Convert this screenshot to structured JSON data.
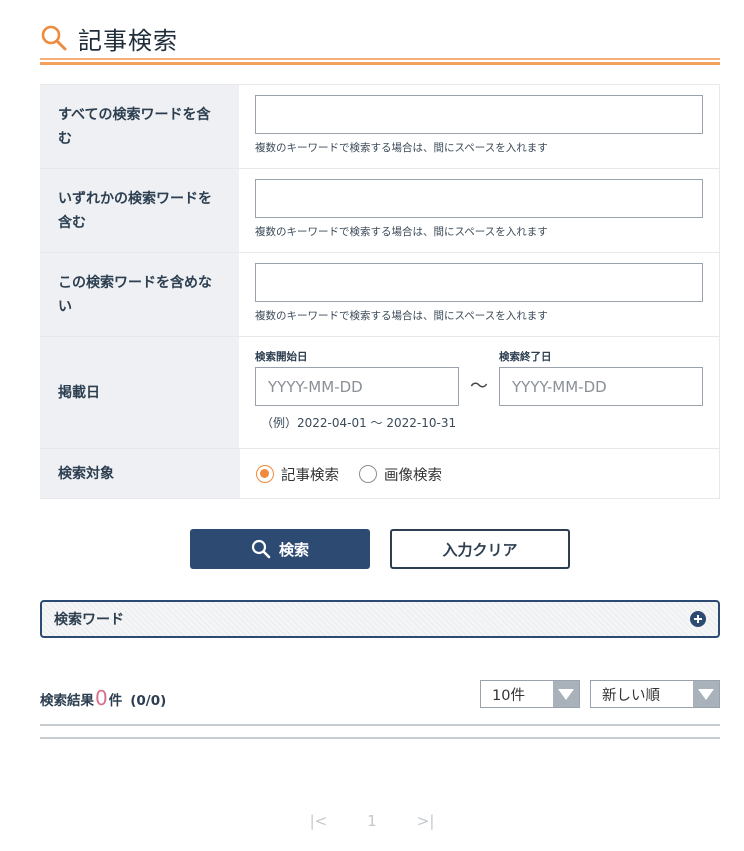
{
  "header": {
    "title": "記事検索",
    "icon": "search-icon",
    "accent_color": "#f3a15f"
  },
  "form": {
    "rows": [
      {
        "label": "すべての検索ワードを含む",
        "value": "",
        "hint": "複数のキーワードで検索する場合は、間にスペースを入れます"
      },
      {
        "label": "いずれかの検索ワードを含む",
        "value": "",
        "hint": "複数のキーワードで検索する場合は、間にスペースを入れます"
      },
      {
        "label": "この検索ワードを含めない",
        "value": "",
        "hint": "複数のキーワードで検索する場合は、間にスペースを入れます"
      }
    ],
    "date": {
      "label": "掲載日",
      "start_label": "検索開始日",
      "start_placeholder": "YYYY-MM-DD",
      "end_label": "検索終了日",
      "end_placeholder": "YYYY-MM-DD",
      "separator": "～",
      "example": "（例）2022-04-01 ～ 2022-10-31"
    },
    "target": {
      "label": "検索対象",
      "options": [
        {
          "label": "記事検索",
          "selected": true
        },
        {
          "label": "画像検索",
          "selected": false
        }
      ]
    }
  },
  "buttons": {
    "search_label": "検索",
    "clear_label": "入力クリア",
    "primary_color": "#2d4a72"
  },
  "keyword_panel": {
    "title": "検索ワード"
  },
  "results": {
    "prefix": "検索結果",
    "count": "0",
    "suffix": "件",
    "fraction": "(0/0)",
    "count_color": "#d96f8c",
    "per_page_value": "10件",
    "sort_value": "新しい順"
  },
  "pagination": {
    "first": "|<",
    "page": "1",
    "last": ">|"
  }
}
